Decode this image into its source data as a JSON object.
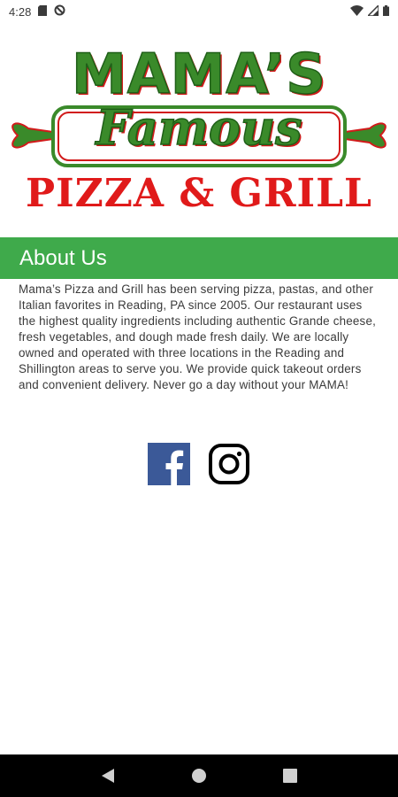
{
  "status_bar": {
    "time": "4:28",
    "icons": [
      "sd-card-icon",
      "no-data-saver-icon",
      "wifi-icon",
      "signal-icon",
      "battery-icon"
    ]
  },
  "logo": {
    "line1": "MAMA’S",
    "line2": "Famous",
    "line3": "PIZZA & GRILL",
    "colors": {
      "green": "#3a8a2a",
      "red": "#e01a1a"
    }
  },
  "about": {
    "title": "About Us",
    "body": "Mama’s Pizza and Grill has been serving pizza, pastas, and other Italian favorites in Reading, PA since 2005. Our restaurant uses the highest quality ingredients including authentic Grande cheese, fresh vegetables, and dough made fresh daily. We are locally owned and operated with three locations in the Reading and Shillington areas to serve you. We provide quick takeout orders and convenient delivery. Never go a day without your MAMA!",
    "header_color": "#3faa4b"
  },
  "social": {
    "items": [
      "facebook-icon",
      "instagram-icon"
    ],
    "facebook_color": "#3b5998"
  },
  "nav_bar": {
    "buttons": [
      "back-icon",
      "home-icon",
      "recents-icon"
    ]
  }
}
